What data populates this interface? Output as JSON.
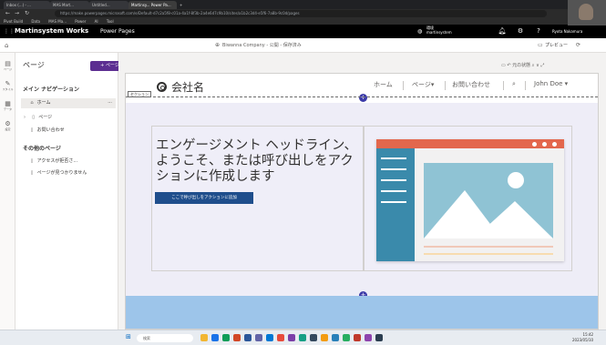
{
  "browser": {
    "tabs": [
      "Inbox (...) - ...",
      "MAS Mart...",
      "Untitled...",
      "Martinsy...  Power Pa...",
      "+"
    ],
    "url": "https://make.powerpages.microsoft.com/e/Default-d7c2a5f8-c01a-4a1f-8f3b-2a4e6d7c9b10/sites/a1b2c3d4-e5f6-7a8b-9c0d/pages",
    "bookmarks": [
      "Pivot Build",
      "Data",
      "MAS Ma...",
      "Power",
      "AI",
      "Tool"
    ]
  },
  "header": {
    "brand": "Martinsystem Works",
    "product": "Power Pages",
    "env_label": "環境",
    "env_name": "martinsystem",
    "user_name": "Ryota Nakamura"
  },
  "toolbar": {
    "site_name": "Biwanna Company - 公開 - 保存済み",
    "preview": "プレビュー"
  },
  "rail": {
    "items": [
      {
        "label": "ページ",
        "icon": "pages-icon",
        "glyph": "▤"
      },
      {
        "label": "スタイル",
        "icon": "style-icon",
        "glyph": "✎"
      },
      {
        "label": "データ",
        "icon": "data-icon",
        "glyph": "▦"
      },
      {
        "label": "設定",
        "icon": "setup-icon",
        "glyph": "⚙"
      }
    ]
  },
  "panel": {
    "title": "ページ",
    "add_button": "+ ページ",
    "main_nav_title": "メイン ナビゲーション",
    "main_nav": [
      {
        "label": "ホーム",
        "icon": "home-icon",
        "glyph": "⌂",
        "selected": true
      },
      {
        "label": "ページ",
        "icon": "page-icon",
        "glyph": "▯",
        "selected": false
      },
      {
        "label": "お問い合わせ",
        "icon": "page-icon",
        "glyph": "▯",
        "selected": false
      }
    ],
    "other_title": "その他のページ",
    "other_pages": [
      {
        "label": "アクセスが拒否さ...",
        "icon": "page-icon",
        "glyph": "▯"
      },
      {
        "label": "ページが見つかりません",
        "icon": "page-icon",
        "glyph": "▯"
      }
    ]
  },
  "canvas": {
    "tools": "▭  ↶ 元の状態   ⌕ ∨   ⤢",
    "site": {
      "company": "会社名",
      "nav": [
        "ホーム",
        "ページ▾",
        "お問い合わせ",
        "⌕",
        "John Doe ▾"
      ],
      "section_label": "セクション",
      "headline": "エンゲージメント ヘッドライン、ようこそ、または呼び出しをアクションに作成します",
      "cta": "ここで呼び出しをアクションに追加"
    }
  },
  "colors": {
    "header_bg": "#000000",
    "accent_purple": "#5c2e91",
    "cta_blue": "#1f4e8c",
    "illus_red": "#e3674d",
    "illus_teal": "#3a8aab",
    "illus_sky": "#8fc3d4",
    "hero_bg": "#eeedf7",
    "band_blue": "#9dc5ea"
  },
  "taskbar": {
    "search": "検索",
    "time": "15:42",
    "date": "2023/05/10"
  }
}
